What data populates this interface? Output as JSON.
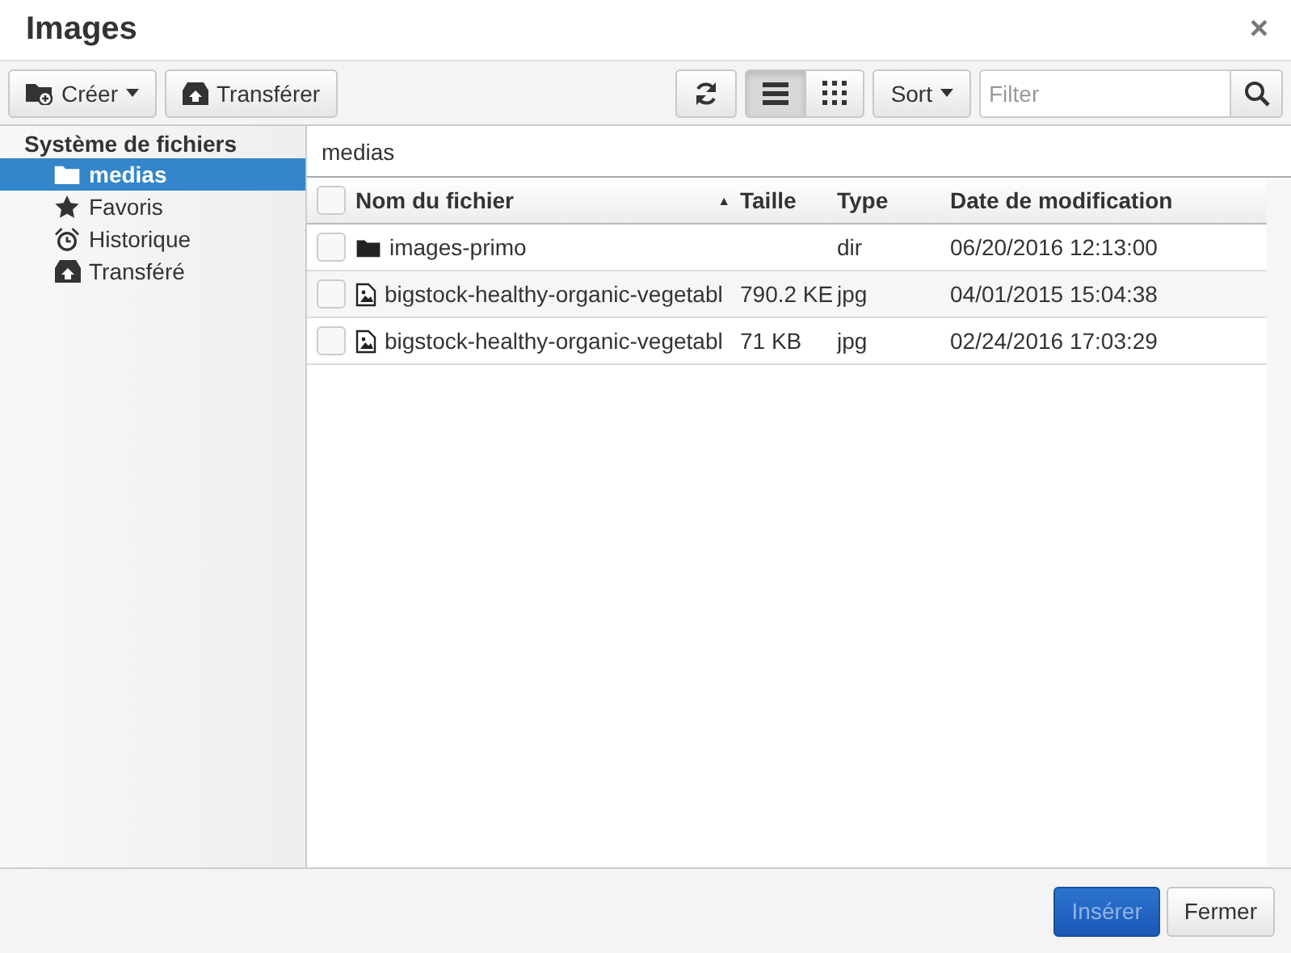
{
  "window": {
    "title": "Images",
    "close": "×"
  },
  "toolbar": {
    "create": "Créer",
    "upload": "Transférer",
    "views": [
      {
        "kind": "list",
        "selected": true
      },
      {
        "kind": "grid",
        "selected": false
      }
    ],
    "sort": "Sort",
    "filter": {
      "placeholder": "Filter"
    }
  },
  "sidebar": {
    "heading": "Système de fichiers",
    "items": [
      {
        "label": "medias",
        "kind": "folder",
        "selected": true
      },
      {
        "label": "Favoris",
        "kind": "star",
        "selected": false
      },
      {
        "label": "Historique",
        "kind": "clock",
        "selected": false
      },
      {
        "label": "Transféré",
        "kind": "upload",
        "selected": false
      }
    ]
  },
  "breadcrumb": "medias",
  "table": {
    "select_all": {
      "checked": false
    },
    "columns": [
      {
        "label": "Nom du fichier",
        "sorted": true
      },
      {
        "label": "Taille",
        "sorted": false
      },
      {
        "label": "Type",
        "sorted": false
      },
      {
        "label": "Date de modification",
        "sorted": false
      }
    ],
    "sort_arrow": "▲",
    "rows": [
      {
        "kind": "folder",
        "name": "images-primo",
        "type": "dir",
        "date": "06/20/2016 12:13:00",
        "checked": false
      },
      {
        "kind": "image",
        "name": "bigstock-healthy-organic-vegetabl",
        "size": "790.2 KE",
        "type": "jpg",
        "date": "04/01/2015 15:04:38",
        "checked": false
      },
      {
        "kind": "image",
        "name": "bigstock-healthy-organic-vegetabl",
        "size": "71 KB",
        "type": "jpg",
        "date": "02/24/2016 17:03:29",
        "checked": false
      }
    ]
  },
  "footer": {
    "buttons": [
      {
        "label": "Insérer",
        "kind": "primary",
        "disabled": true
      },
      {
        "label": "Fermer",
        "kind": "default",
        "disabled": false
      }
    ]
  }
}
